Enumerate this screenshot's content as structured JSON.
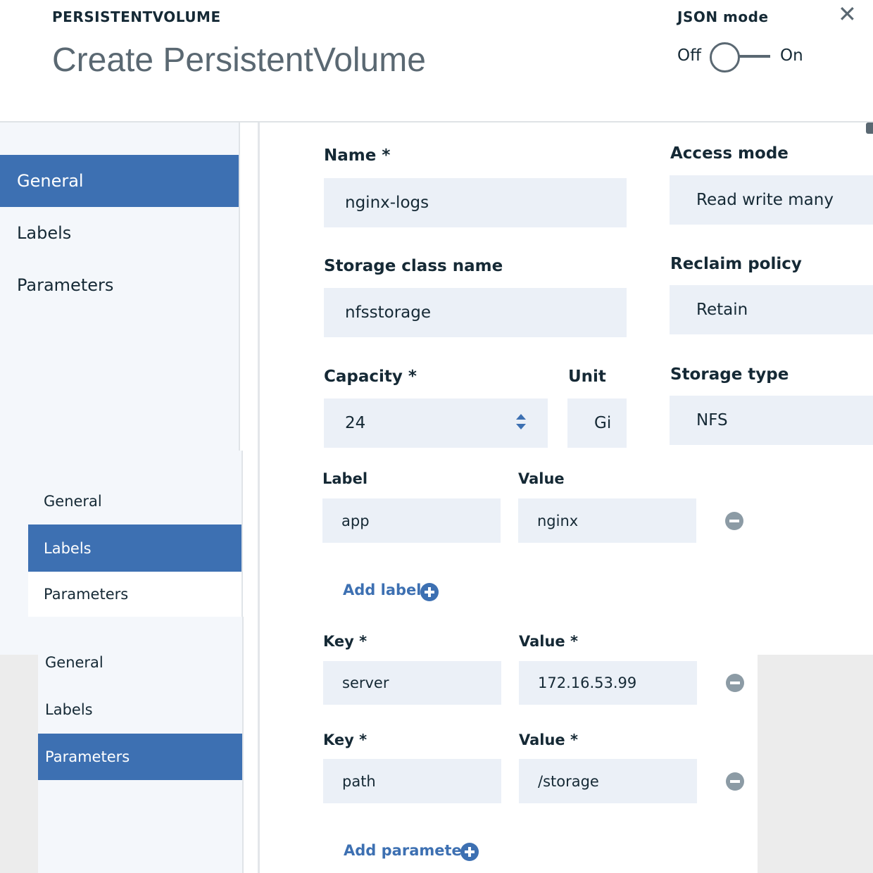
{
  "header": {
    "eyebrow": "PERSISTENTVOLUME",
    "title": "Create PersistentVolume",
    "json_mode_label": "JSON mode",
    "toggle_off": "Off",
    "toggle_on": "On",
    "close_icon": "close-icon"
  },
  "nav_general": {
    "items": [
      "General",
      "Labels",
      "Parameters"
    ],
    "active": "General"
  },
  "nav_labels": {
    "items": [
      "General",
      "Labels",
      "Parameters"
    ],
    "active": "Labels"
  },
  "nav_parameters": {
    "items": [
      "General",
      "Labels",
      "Parameters"
    ],
    "active": "Parameters"
  },
  "general": {
    "name_label": "Name *",
    "name_value": "nginx-logs",
    "access_mode_label": "Access mode",
    "access_mode_value": "Read write many",
    "storage_class_label": "Storage class name",
    "storage_class_value": "nfsstorage",
    "reclaim_policy_label": "Reclaim policy",
    "reclaim_policy_value": "Retain",
    "capacity_label": "Capacity *",
    "capacity_value": "24",
    "unit_label": "Unit",
    "unit_value": "Gi",
    "storage_type_label": "Storage type",
    "storage_type_value": "NFS"
  },
  "labels": {
    "label_header": "Label",
    "value_header": "Value",
    "rows": [
      {
        "key": "app",
        "value": "nginx"
      }
    ],
    "add_label": "Add label"
  },
  "parameters": {
    "rows": [
      {
        "key_header": "Key *",
        "value_header": "Value *",
        "key": "server",
        "value": "172.16.53.99"
      },
      {
        "key_header": "Key *",
        "value_header": "Value *",
        "key": "path",
        "value": "/storage"
      }
    ],
    "add_parameter": "Add parameter"
  },
  "colors": {
    "accent": "#3d70b2",
    "field_bg": "#ebf0f7",
    "nav_bg": "#f4f7fb",
    "text": "#152935",
    "muted": "#5a6872"
  }
}
